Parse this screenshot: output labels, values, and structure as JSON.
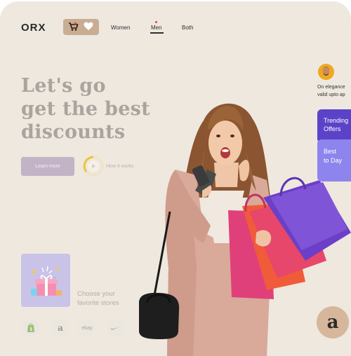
{
  "brand": {
    "logo": "ORX"
  },
  "nav": {
    "icons": [
      "cart-icon",
      "heart-icon"
    ],
    "links": {
      "women": "Women",
      "men": "Men",
      "both": "Both"
    },
    "active": "Men"
  },
  "hero": {
    "title_lines": [
      "Let's go",
      "get the best",
      "discounts"
    ],
    "cta_label": "Learn more",
    "how_label": "How it works"
  },
  "stores": {
    "heading_lines": [
      "Choose your",
      "favorite stores"
    ],
    "items": [
      "shopify",
      "a",
      "ebay",
      "nike"
    ]
  },
  "side": {
    "promo_line_1": "On elegance",
    "promo_line_2": "valid upto ap",
    "trending": [
      "Trending",
      "Offers"
    ],
    "best": [
      "Best",
      "to Day"
    ],
    "amazon_badge": "a"
  },
  "colors": {
    "background": "#eee8df",
    "nav_pill": "#c9ad93",
    "cta": "#c3b3c6",
    "trending": "#5b43c9",
    "best": "#8e84ee",
    "amazon_badge": "#d6b79b"
  }
}
